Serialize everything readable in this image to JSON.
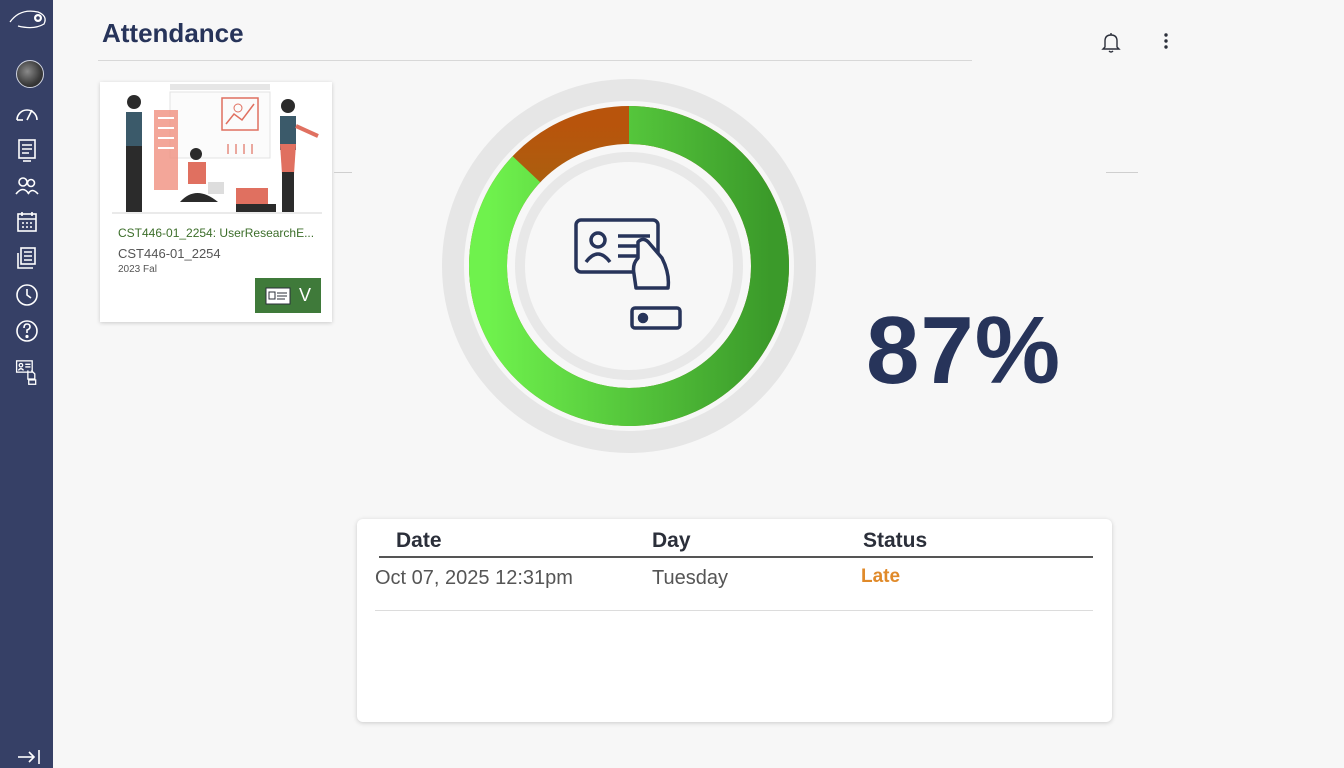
{
  "header": {
    "title": "Attendance"
  },
  "sidebar": {
    "items": [
      {
        "icon": "avatar"
      },
      {
        "icon": "dashboard-icon"
      },
      {
        "icon": "courses-icon"
      },
      {
        "icon": "groups-icon"
      },
      {
        "icon": "calendar-icon"
      },
      {
        "icon": "inbox-icon"
      },
      {
        "icon": "history-icon"
      },
      {
        "icon": "help-icon"
      },
      {
        "icon": "attendance-icon"
      }
    ]
  },
  "course": {
    "name": "CST446-01_2254: UserResearchE...",
    "code": "CST446-01_2254",
    "term": "2023 Fal",
    "button_label": "V"
  },
  "attendance": {
    "percent_label": "87%",
    "percent_value": 0.87
  },
  "table": {
    "headers": [
      "Date",
      "Day",
      "Status"
    ],
    "rows": [
      {
        "date": "Oct 07, 2025 12:31pm",
        "day": "Tuesday",
        "status": "Late"
      }
    ]
  },
  "colors": {
    "sidebar": "#364066",
    "accent_green": "#6ee04a",
    "accent_orange": "#b85a10",
    "status_late": "#e08a2a",
    "title": "#27345a"
  }
}
